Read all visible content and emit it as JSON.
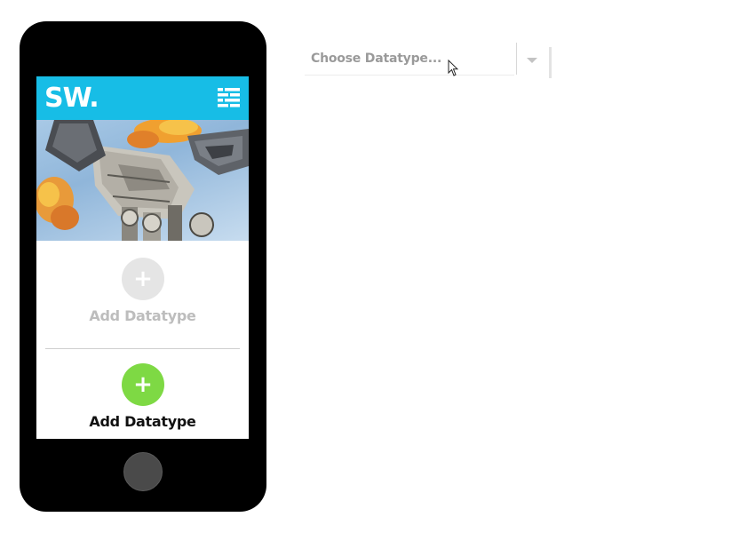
{
  "phone": {
    "app_logo": "SW.",
    "menu_icon": "list-menu-icon",
    "hero_icon": "at-at-walker-illustration",
    "add_disabled": {
      "icon": "plus-icon",
      "symbol": "+",
      "label": "Add Datatype",
      "color": "#e5e5e5",
      "text_color": "#bdbdbd"
    },
    "add_active": {
      "icon": "plus-icon",
      "symbol": "+",
      "label": "Add Datatype",
      "color": "#7ed944",
      "text_color": "#111111"
    }
  },
  "dropdown": {
    "placeholder": "Choose Datatype...",
    "arrow_icon": "caret-down-icon"
  },
  "colors": {
    "header": "#17bde6",
    "phone_body": "#000000",
    "home_button": "#4a4a4a"
  }
}
